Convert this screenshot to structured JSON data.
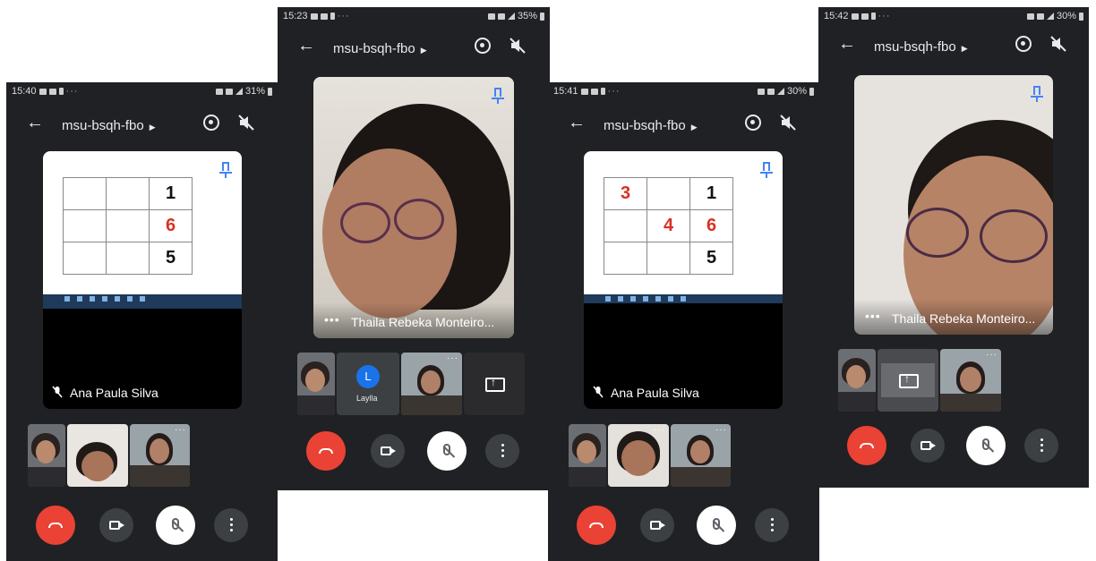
{
  "meeting": {
    "title": "msu-bsqh-fbo"
  },
  "screens": [
    {
      "id": "screen1",
      "time": "15:40",
      "battery": "31%",
      "main_tile": {
        "kind": "screen_share",
        "presenter": "Ana Paula Silva",
        "grid": [
          [
            "",
            "",
            "1"
          ],
          [
            "",
            "",
            "6"
          ],
          [
            "",
            "",
            "5"
          ]
        ],
        "red_cells": [
          "1.2"
        ]
      }
    },
    {
      "id": "screen2",
      "time": "15:23",
      "battery": "35%",
      "main_tile": {
        "kind": "camera",
        "participant": "Thaila Rebeka Monteiro..."
      },
      "thumbnails": [
        {
          "kind": "camera"
        },
        {
          "kind": "avatar",
          "initial": "L",
          "label": "Laylla"
        },
        {
          "kind": "camera"
        },
        {
          "kind": "screen_share"
        }
      ]
    },
    {
      "id": "screen3",
      "time": "15:41",
      "battery": "30%",
      "main_tile": {
        "kind": "screen_share",
        "presenter": "Ana Paula Silva",
        "grid": [
          [
            "3",
            "",
            "1"
          ],
          [
            "",
            "4",
            "6"
          ],
          [
            "",
            "",
            "5"
          ]
        ],
        "red_cells": [
          "0.0",
          "1.1",
          "1.2"
        ]
      }
    },
    {
      "id": "screen4",
      "time": "15:42",
      "battery": "30%",
      "main_tile": {
        "kind": "camera",
        "participant": "Thaila Rebeka Monteiro..."
      }
    }
  ],
  "icons": {
    "back": "arrow-left-icon",
    "participants_caret": "caret-right-icon",
    "switch_camera": "switch-camera-icon",
    "speaker": "speaker-off-icon",
    "pin": "pin-icon",
    "end_call": "end-call-icon",
    "camera": "camera-icon",
    "mic": "mic-off-icon",
    "more": "more-vertical-icon"
  },
  "colors": {
    "end_call": "#ea4335",
    "background": "#202124",
    "pin": "#4285f4",
    "red_digit": "#d93025",
    "avatar": "#1a73e8"
  }
}
